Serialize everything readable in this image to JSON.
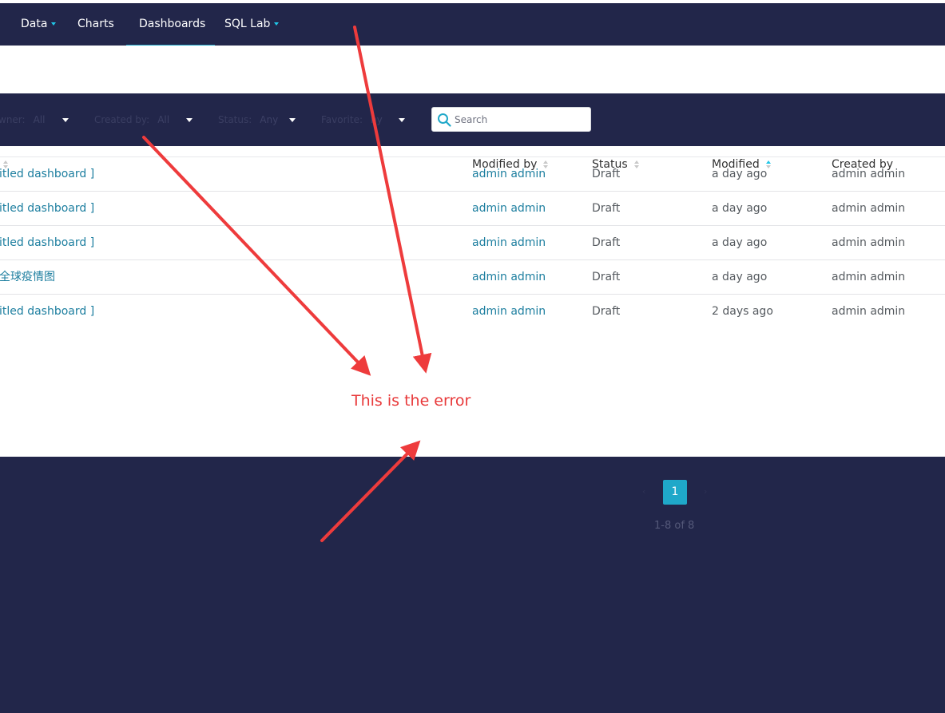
{
  "nav": {
    "items": [
      {
        "label": "Data",
        "has_caret": true
      },
      {
        "label": "Charts",
        "has_caret": false
      },
      {
        "label": "Dashboards",
        "has_caret": false,
        "active": true
      },
      {
        "label": "SQL Lab",
        "has_caret": true
      }
    ]
  },
  "filters": [
    {
      "label": "wner:",
      "value": "All"
    },
    {
      "label": "Created by:",
      "value": "All"
    },
    {
      "label": "Status:",
      "value": "Any"
    },
    {
      "label": "Favorite:",
      "value": "ny"
    }
  ],
  "search": {
    "placeholder": "Search"
  },
  "table": {
    "columns": [
      {
        "label": "",
        "sortable": true
      },
      {
        "label": "Modified by",
        "sortable": true
      },
      {
        "label": "Status",
        "sortable": true
      },
      {
        "label": "Modified",
        "sortable": true,
        "sorted": "asc"
      },
      {
        "label": "Created by",
        "sortable": false
      }
    ],
    "rows": [
      {
        "title": "itled dashboard ]",
        "modified_by": "admin admin",
        "status": "Draft",
        "modified": "a day ago",
        "created_by": "admin admin"
      },
      {
        "title": "itled dashboard ]",
        "modified_by": "admin admin",
        "status": "Draft",
        "modified": "a day ago",
        "created_by": "admin admin"
      },
      {
        "title": "itled dashboard ]",
        "modified_by": "admin admin",
        "status": "Draft",
        "modified": "a day ago",
        "created_by": "admin admin"
      },
      {
        "title": "全球疫情图",
        "modified_by": "admin admin",
        "status": "Draft",
        "modified": "a day ago",
        "created_by": "admin admin"
      },
      {
        "title": "itled dashboard ]",
        "modified_by": "admin admin",
        "status": "Draft",
        "modified": "2 days ago",
        "created_by": "admin admin"
      }
    ]
  },
  "annotation": {
    "text": "This is the error",
    "color": "#e8393a"
  },
  "pagination": {
    "current_page": "1",
    "prev_symbol": "‹",
    "next_symbol": "›",
    "count_text": "1-8 of 8"
  },
  "colors": {
    "navbar": "#22264a",
    "accent": "#1fa8c9",
    "link": "#1c7e9f",
    "caret": "#20c7e8"
  }
}
